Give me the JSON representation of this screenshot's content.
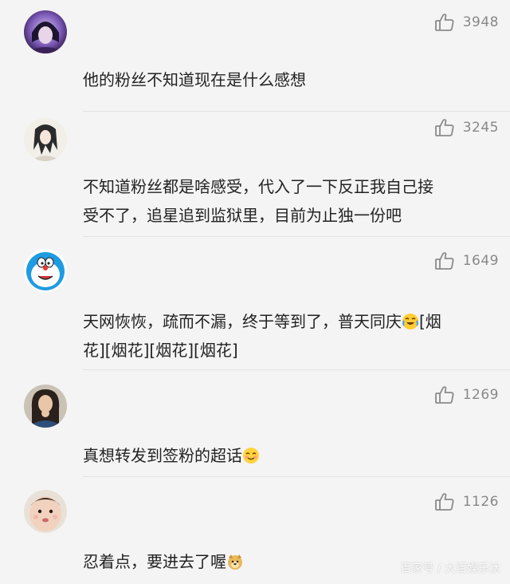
{
  "comments": [
    {
      "likes": "3948",
      "text": "他的粉丝不知道现在是什么感想",
      "avatar": "portrait-purple-avatar"
    },
    {
      "likes": "3245",
      "text_line1": "不知道粉丝都是啥感受，代入了一下反正我自己接",
      "text_line2": "受不了，追星追到监狱里，目前为止独一份吧",
      "avatar": "ink-drawing-avatar"
    },
    {
      "likes": "1649",
      "text_line1": "天网恢恢，疏而不漏，终于等到了，普天同庆",
      "text_line1b": "[烟",
      "text_line2": "花][烟花][烟花][烟花]",
      "avatar": "doraemon-avatar"
    },
    {
      "likes": "1269",
      "text": "真想转发到签粉的超话",
      "avatar": "girl-avatar"
    },
    {
      "likes": "1126",
      "text": "忍着点，要进去了喔",
      "avatar": "child-avatar"
    }
  ],
  "watermark": "百家号 / 大百娱乐汰",
  "colors": {
    "background": "#f4f4f4",
    "text": "#222222",
    "like_count": "#888888"
  }
}
